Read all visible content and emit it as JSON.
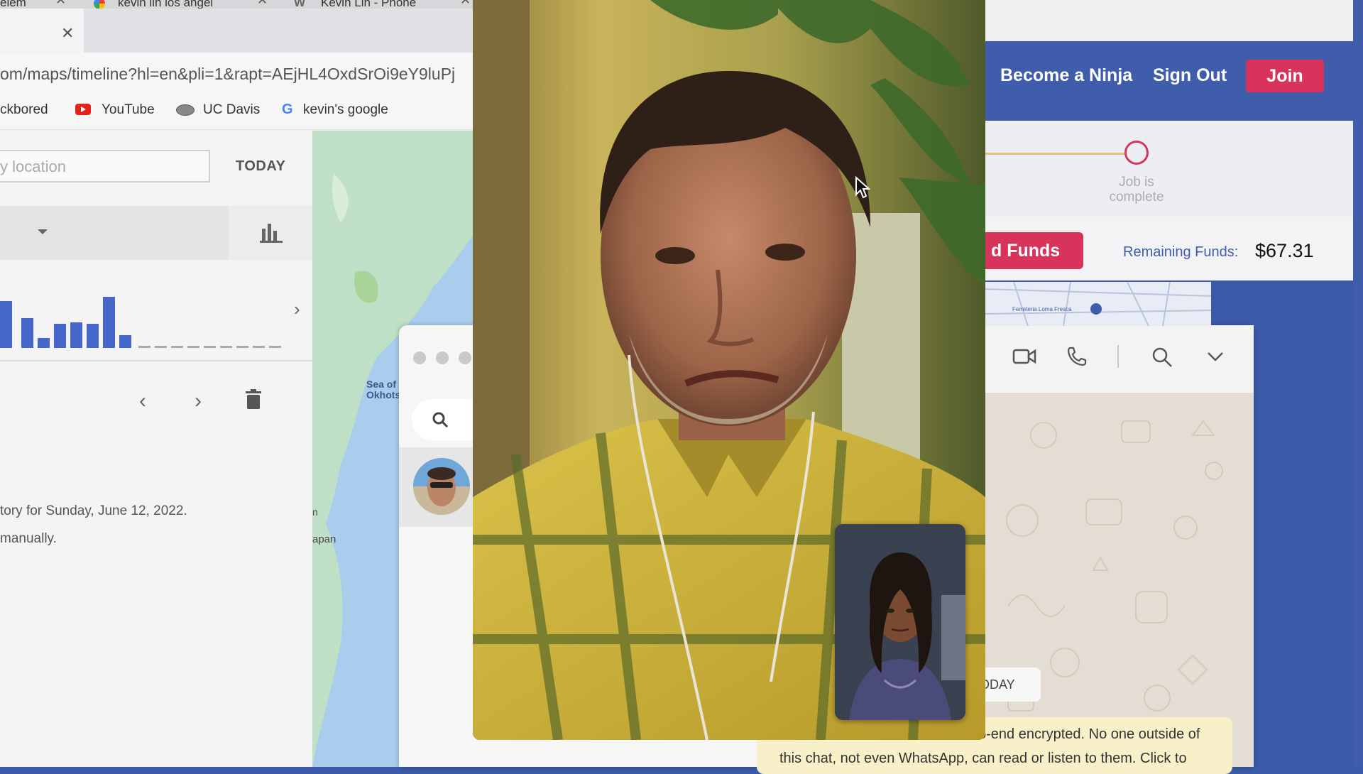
{
  "browser": {
    "tabs": [
      {
        "label": "elem"
      },
      {
        "label": "kevin lin los angel"
      },
      {
        "label": "Kevin Lin - Phone"
      }
    ],
    "url": "om/maps/timeline?hl=en&pli=1&rapt=AEjHL4OxdSrOi9eY9luPj",
    "bookmarks": [
      {
        "label": "ckbored"
      },
      {
        "label": "YouTube"
      },
      {
        "label": "UC Davis"
      },
      {
        "label": "kevin's google"
      }
    ]
  },
  "timeline": {
    "location_placeholder": "y location",
    "today_label": "TODAY",
    "histogram_values": [
      0.55,
      0.35,
      0.12,
      0.28,
      0.3,
      0.28,
      0.6,
      0.15
    ],
    "history_text": "tory for Sunday, June 12, 2022.",
    "manual_text": "manually."
  },
  "map": {
    "sea_label": "Sea of\nOkhots",
    "japan_label": "apan",
    "edge_label": "n"
  },
  "whatsapp": {
    "today_label": "ODAY",
    "encryption_line1": "o-end encrypted. No one outside of",
    "encryption_line2": "this chat, not even WhatsApp, can read or listen to them. Click to"
  },
  "taskpage": {
    "nav_become": "Become a Ninja",
    "nav_signout": "Sign Out",
    "nav_join": "Join",
    "progress_label": "Job is complete",
    "add_funds": "d Funds",
    "remaining_label": "Remaining Funds:",
    "remaining_value": "$67.31",
    "map_label": "Ferreteria Loma Fresca"
  },
  "colors": {
    "brand_blue": "#3f5dab",
    "brand_red": "#d8345b",
    "chart_blue": "#4467c9"
  }
}
